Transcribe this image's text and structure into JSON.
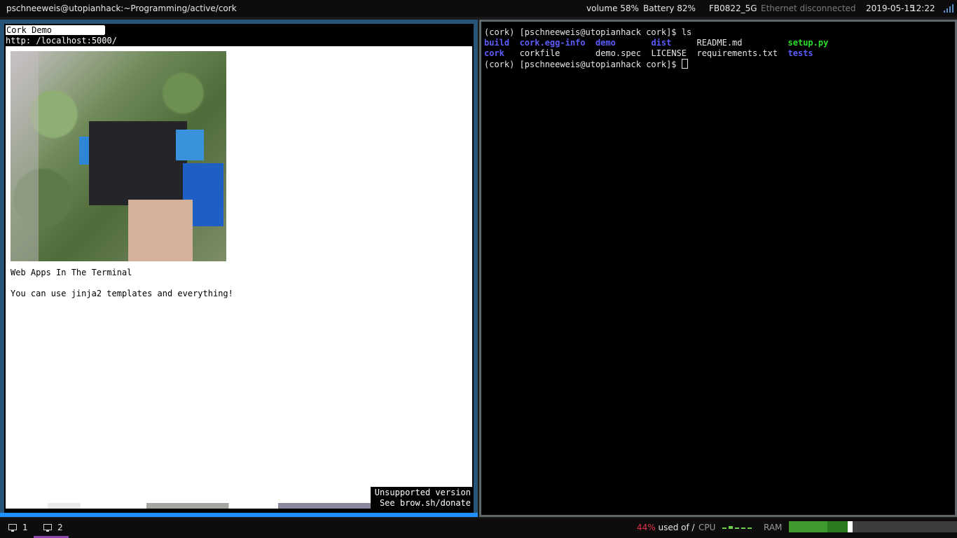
{
  "topbar": {
    "window_title": "pschneeweis@utopianhack:~Programming/active/cork",
    "volume": "volume 58%",
    "battery": "Battery 82%",
    "wifi": "FB0822_5G",
    "ethernet": "Ethernet disconnected",
    "date": "2019-05-15",
    "time": "12:22",
    "wifi_icon": "wifi-signal-icon"
  },
  "browser": {
    "tab_title": "Cork Demo",
    "url": "http: /localhost:5000/",
    "page_heading": "Web Apps In The Terminal",
    "page_text": "You can use jinja2 templates and everything!",
    "notice_line1": "Unsupported version",
    "notice_line2": "See brow.sh/donate"
  },
  "terminal": {
    "prompt": "(cork) [pschneeweis@utopianhack cork]$ ",
    "command": "ls",
    "entries": [
      {
        "name": "build",
        "kind": "dir"
      },
      {
        "name": "cork.egg-info",
        "kind": "dir"
      },
      {
        "name": "demo",
        "kind": "dir"
      },
      {
        "name": "dist",
        "kind": "dir"
      },
      {
        "name": "README.md",
        "kind": "file"
      },
      {
        "name": "setup.py",
        "kind": "exe"
      },
      {
        "name": "cork",
        "kind": "dir"
      },
      {
        "name": "corkfile",
        "kind": "file"
      },
      {
        "name": "demo.spec",
        "kind": "file"
      },
      {
        "name": "LICENSE",
        "kind": "file"
      },
      {
        "name": "requirements.txt",
        "kind": "file"
      },
      {
        "name": "tests",
        "kind": "dir"
      }
    ],
    "colors": {
      "dir": "#5c5cff",
      "exe": "#29e029",
      "text": "#e6e6e6"
    }
  },
  "bottombar": {
    "workspace1": "1",
    "workspace2": "2",
    "disk_pct": "44%",
    "disk_label": " used of /",
    "cpu_label": "CPU",
    "ram_label": "RAM",
    "ram_usage": 0.35,
    "workspace_icon": "desktop-icon"
  },
  "colors": {
    "focused_border": "#1e90ff",
    "workspace_accent": "#8e44ad",
    "disk_alert": "#e0304a"
  }
}
